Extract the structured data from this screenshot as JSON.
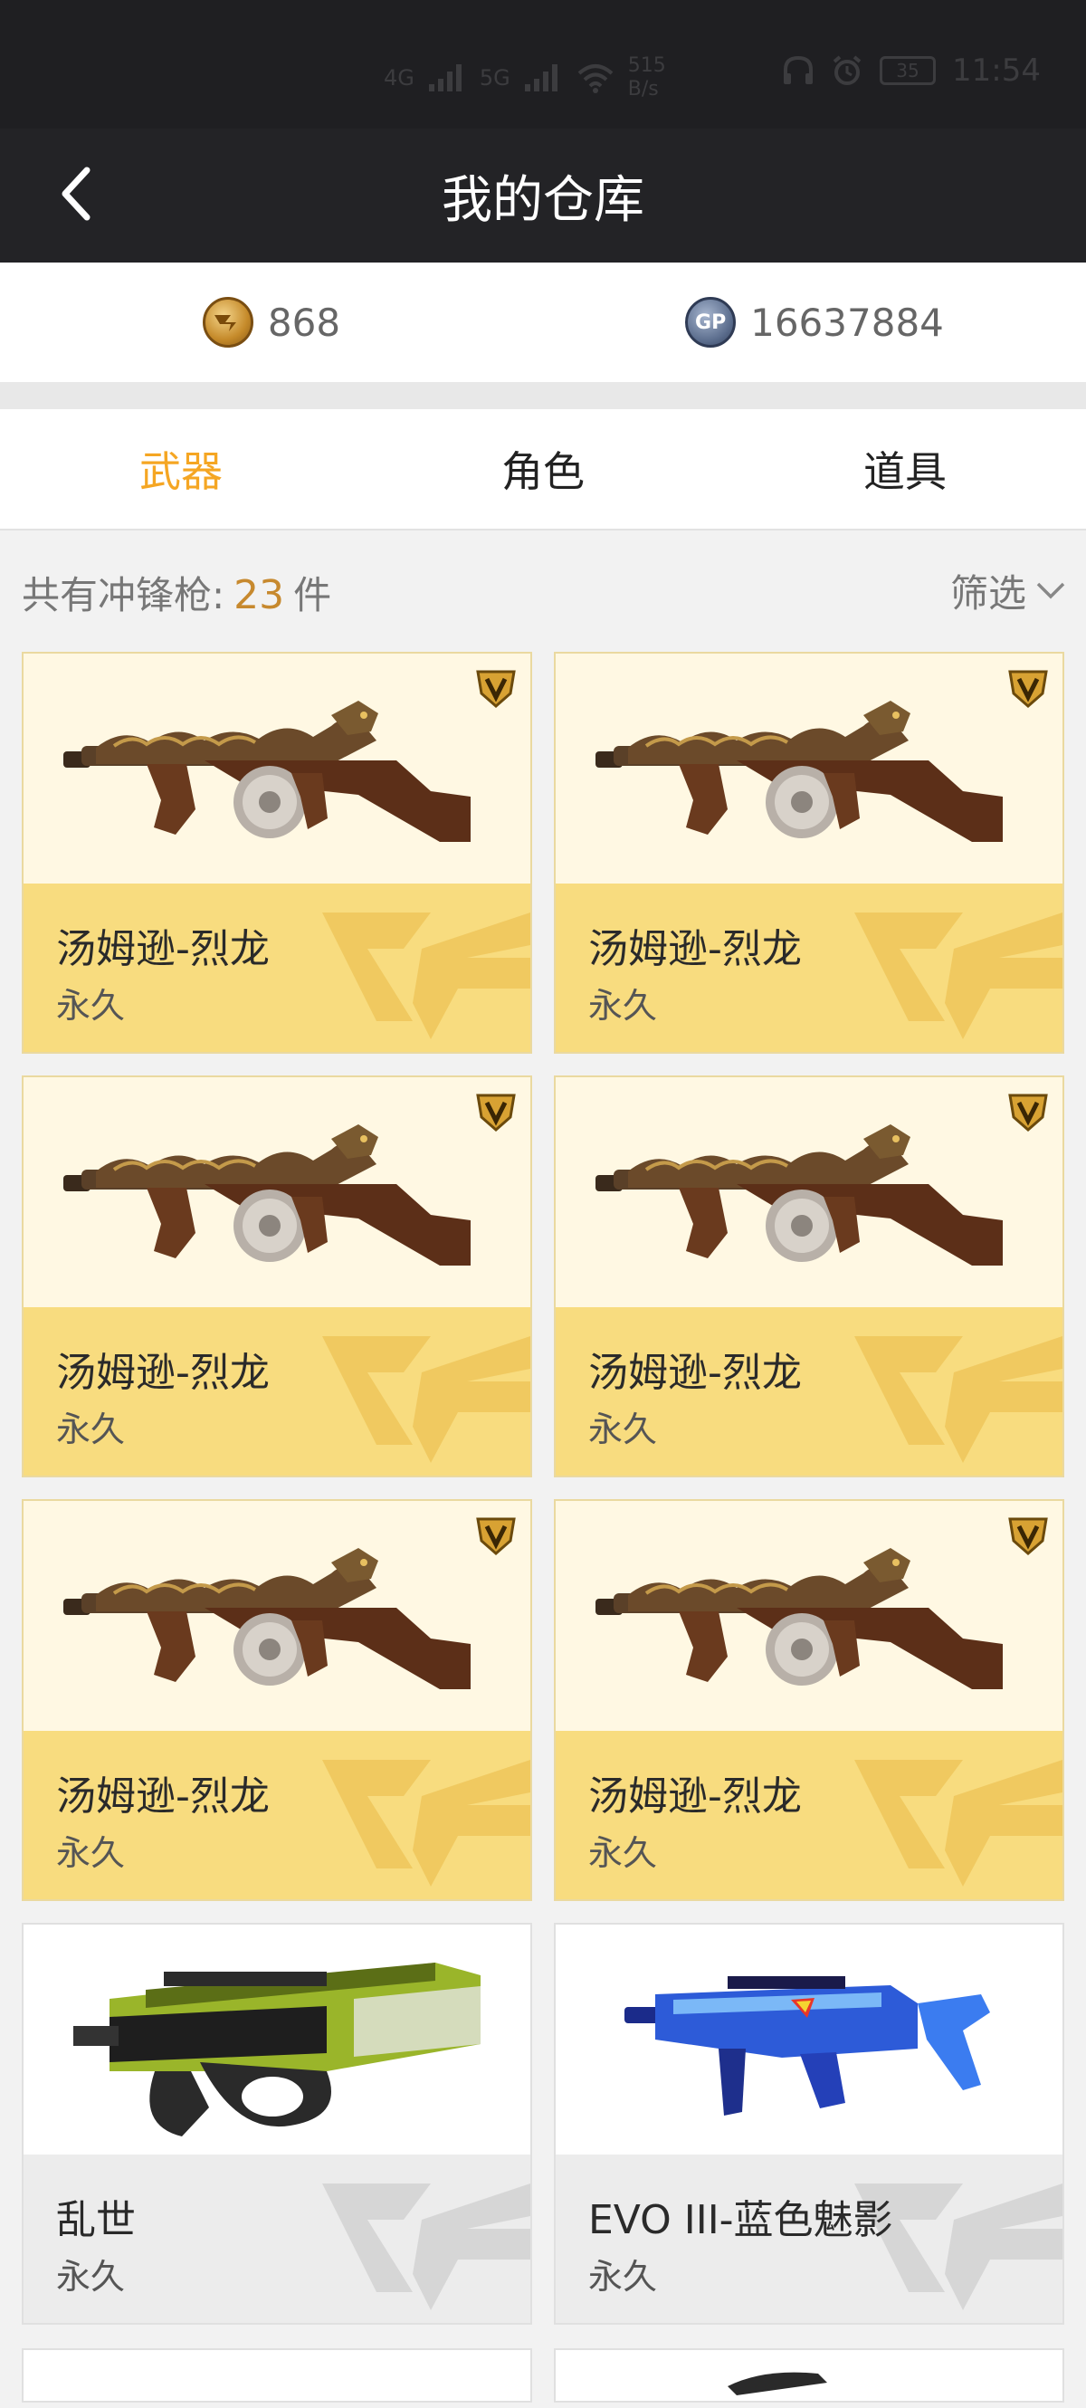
{
  "status_bar": {
    "time": "11:54",
    "battery": "35",
    "net_speed_value": "515",
    "net_speed_unit": "B/s",
    "signal_1": "4G",
    "signal_2": "5G"
  },
  "nav": {
    "title": "我的仓库",
    "back_icon": "chevron-left-icon"
  },
  "currency": {
    "cf_points": {
      "icon": "cf-coin-icon",
      "value": "868"
    },
    "gp": {
      "icon": "gp-coin-icon",
      "icon_text": "GP",
      "value": "16637884"
    }
  },
  "tabs": [
    {
      "label": "武器",
      "active": true
    },
    {
      "label": "角色",
      "active": false
    },
    {
      "label": "道具",
      "active": false
    }
  ],
  "filter_row": {
    "prefix": "共有冲锋枪:",
    "count": "23",
    "suffix": "件",
    "filter_label": "筛选",
    "filter_icon": "chevron-down-icon"
  },
  "items": [
    {
      "name": "汤姆逊-烈龙",
      "duration": "永久",
      "vip": true,
      "style": "gold",
      "weapon": "tommy-gun-dragon"
    },
    {
      "name": "汤姆逊-烈龙",
      "duration": "永久",
      "vip": true,
      "style": "gold",
      "weapon": "tommy-gun-dragon"
    },
    {
      "name": "汤姆逊-烈龙",
      "duration": "永久",
      "vip": true,
      "style": "gold",
      "weapon": "tommy-gun-dragon"
    },
    {
      "name": "汤姆逊-烈龙",
      "duration": "永久",
      "vip": true,
      "style": "gold",
      "weapon": "tommy-gun-dragon"
    },
    {
      "name": "汤姆逊-烈龙",
      "duration": "永久",
      "vip": true,
      "style": "gold",
      "weapon": "tommy-gun-dragon"
    },
    {
      "name": "汤姆逊-烈龙",
      "duration": "永久",
      "vip": true,
      "style": "gold",
      "weapon": "tommy-gun-dragon"
    },
    {
      "name": "乱世",
      "duration": "永久",
      "vip": false,
      "style": "plain",
      "weapon": "p90-green"
    },
    {
      "name": "EVO III-蓝色魅影",
      "duration": "永久",
      "vip": false,
      "style": "plain",
      "weapon": "evo3-blue"
    }
  ],
  "colors": {
    "accent": "#f5a623",
    "count": "#c7892e",
    "gold_panel": "#f8dc7f",
    "gold_bg": "#fff8e3",
    "nav_bg": "#232326"
  }
}
